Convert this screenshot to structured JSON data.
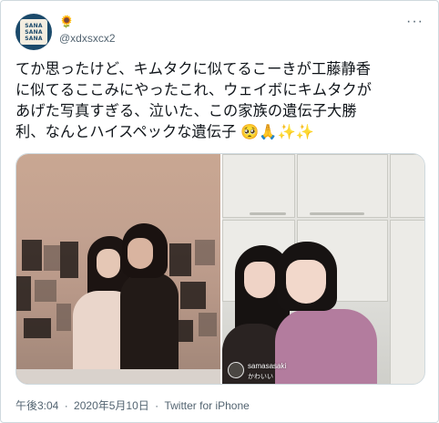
{
  "tweet": {
    "author": {
      "display_name_emoji": "🌻",
      "handle": "@xdxsxcx2",
      "avatar_text": [
        "SANA",
        "SANA",
        "SANA"
      ]
    },
    "more_label": "···",
    "text_lines": [
      "てか思ったけど、キムタクに似てるこーきが工藤静香",
      "に似てるここみにやったこれ、ウェイボにキムタクが",
      "あげた写真すぎる、泣いた、この家族の遺伝子大勝",
      "利、なんとハイスペックな遺伝子"
    ],
    "text_emojis": "🥺🙏✨✨",
    "media": {
      "right_overlay_user": "samasasaki",
      "right_overlay_caption": "かわいい"
    },
    "time": "午後3:04",
    "date": "2020年5月10日",
    "separator": "·",
    "source": "Twitter for iPhone"
  },
  "colors": {
    "text_primary": "#0f1419",
    "text_secondary": "#536471",
    "border": "#cfd9de",
    "avatar_bg": "#1b4a6b"
  }
}
